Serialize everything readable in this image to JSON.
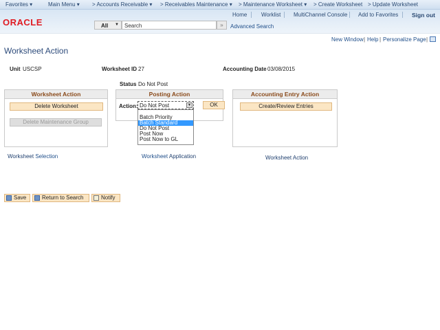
{
  "nav": {
    "items": [
      "Favorites ▾",
      "Main Menu ▾",
      "> Accounts Receivable ▾",
      "> Receivables Maintenance ▾",
      "> Maintenance Worksheet ▾",
      "> Create Worksheet",
      "> Update Worksheet",
      "›"
    ]
  },
  "header": {
    "links": [
      "Home",
      "Worklist",
      "MultiChannel Console",
      "Add to Favorites"
    ],
    "signout": "Sign out",
    "logo": "ORACLE",
    "search_scope": "All",
    "search_placeholder": "Search",
    "go": "»",
    "advanced_search": "Advanced Search"
  },
  "pagebar": {
    "new_window": "New Window",
    "help": "Help",
    "personalize": "Personalize Page"
  },
  "page": {
    "title": "Worksheet Action",
    "unit_label": "Unit",
    "unit": "USCSP",
    "ws_id_label": "Worksheet ID",
    "ws_id": "27",
    "acct_date_label": "Accounting Date",
    "acct_date": "03/08/2015",
    "status_label": "Status",
    "status": "Do Not Post"
  },
  "ws_action": {
    "title": "Worksheet Action",
    "delete": "Delete Worksheet",
    "delete_group": "Delete Maintenance Group"
  },
  "posting": {
    "title": "Posting Action",
    "action_label": "Action:",
    "selected": "Do Not Post",
    "ok": "OK",
    "options": [
      "",
      "Batch Priority",
      "Batch Standard",
      "Do Not Post",
      "Post Now",
      "Post Now to GL"
    ],
    "highlighted": "Batch Standard"
  },
  "acct_entry": {
    "title": "Accounting Entry Action",
    "create": "Create/Review Entries"
  },
  "bottom_links": {
    "selection_a": "Worksheet",
    "selection_b": "Selection",
    "application_a": "Worksheet",
    "application_b": "Application",
    "action": "Worksheet Action"
  },
  "toolbar": {
    "save": "Save",
    "return": "Return to Search",
    "notify": "Notify"
  }
}
